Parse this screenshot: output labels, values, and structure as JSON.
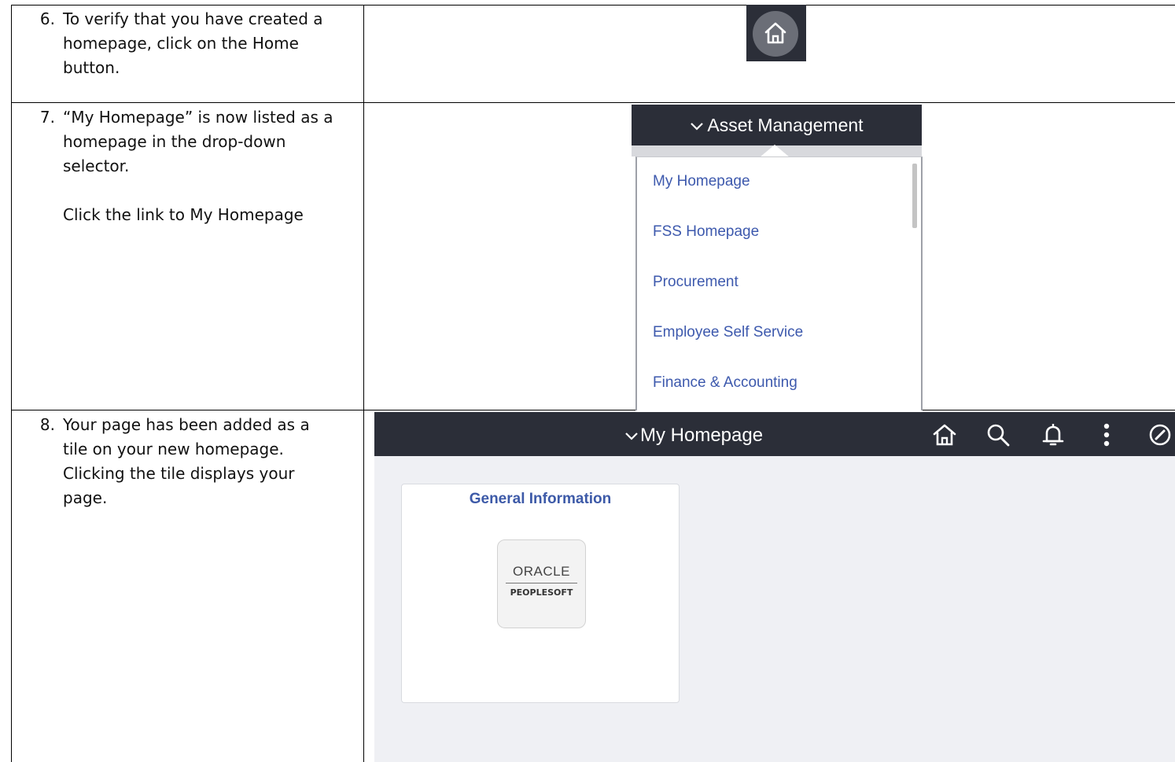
{
  "steps": [
    {
      "number": "6.",
      "lines": [
        "To verify that you have created a homepage, click on the Home button."
      ]
    },
    {
      "number": "7.",
      "lines": [
        "“My Homepage” is now listed as a homepage in the drop-down selector.",
        "Click the link to My Homepage"
      ]
    },
    {
      "number": "8.",
      "lines": [
        "Your page has been added as a tile on your new homepage. Clicking the tile displays your page."
      ]
    }
  ],
  "home_button": {
    "icon": "home-icon"
  },
  "dropdown": {
    "title": "Asset Management",
    "chevron": "⌄",
    "items": [
      "My Homepage",
      "FSS Homepage",
      "Procurement",
      "Employee Self Service",
      "Finance & Accounting"
    ],
    "link_color": "#3d59ad"
  },
  "homepage": {
    "title": "My Homepage",
    "header_icons": [
      "home-icon",
      "search-icon",
      "bell-icon",
      "more-vertical-icon",
      "navbar-compass-icon"
    ],
    "tile": {
      "title": "General Information",
      "logo_top": "ORACLE",
      "logo_bottom": "PEOPLESOFT"
    },
    "header_color": "#2b2e38",
    "background_color": "#eff0f4"
  }
}
